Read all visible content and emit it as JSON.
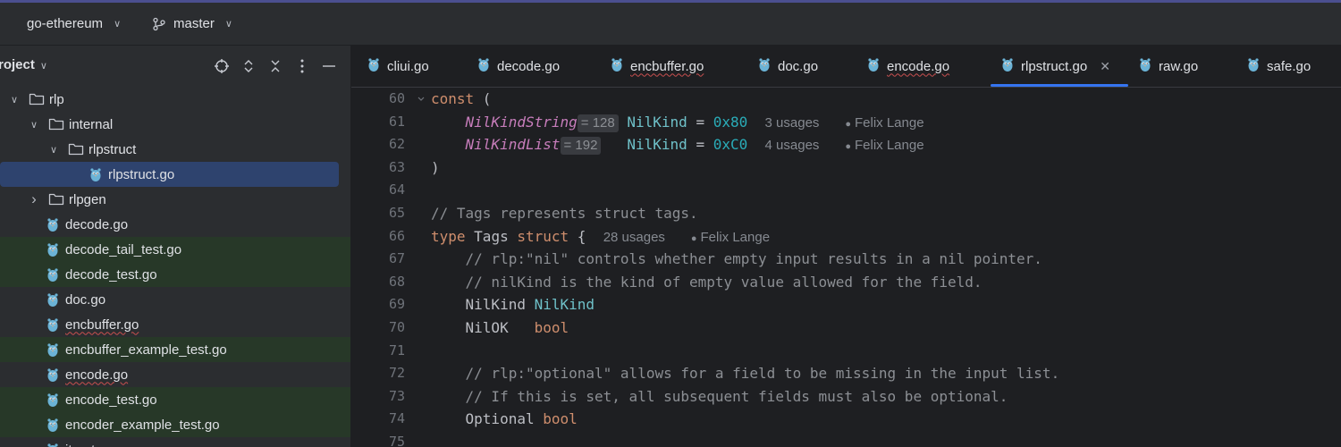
{
  "titlebar": {
    "project_name": "go-ethereum",
    "branch": "master"
  },
  "project_panel": {
    "title": "roject",
    "icons": [
      "locate-icon",
      "expand-collapse-icon",
      "collapse-all-icon",
      "more-icon",
      "minimize-icon"
    ],
    "tree": [
      {
        "label": "rlp",
        "type": "folder",
        "expanded": true,
        "level": 0
      },
      {
        "label": "internal",
        "type": "folder",
        "expanded": true,
        "level": 1
      },
      {
        "label": "rlpstruct",
        "type": "folder",
        "expanded": true,
        "level": 2
      },
      {
        "label": "rlpstruct.go",
        "type": "go-file",
        "selected": true,
        "level": 3
      },
      {
        "label": "rlpgen",
        "type": "folder",
        "expanded": false,
        "level": 1
      },
      {
        "label": "decode.go",
        "type": "go-file",
        "level": 1
      },
      {
        "label": "decode_tail_test.go",
        "type": "go-file",
        "test": true,
        "level": 1
      },
      {
        "label": "decode_test.go",
        "type": "go-file",
        "test": true,
        "level": 1
      },
      {
        "label": "doc.go",
        "type": "go-file",
        "level": 1
      },
      {
        "label": "encbuffer.go",
        "type": "go-file",
        "error": true,
        "level": 1
      },
      {
        "label": "encbuffer_example_test.go",
        "type": "go-file",
        "test": true,
        "level": 1
      },
      {
        "label": "encode.go",
        "type": "go-file",
        "error": true,
        "level": 1
      },
      {
        "label": "encode_test.go",
        "type": "go-file",
        "test": true,
        "level": 1
      },
      {
        "label": "encoder_example_test.go",
        "type": "go-file",
        "test": true,
        "level": 1
      },
      {
        "label": "iterator.go",
        "type": "go-file",
        "level": 1
      }
    ]
  },
  "tabs": [
    {
      "label": "cliui.go",
      "error": false
    },
    {
      "label": "decode.go",
      "error": false
    },
    {
      "label": "encbuffer.go",
      "error": true
    },
    {
      "label": "doc.go",
      "error": false
    },
    {
      "label": "encode.go",
      "error": true
    },
    {
      "label": "rlpstruct.go",
      "error": false,
      "active": true
    },
    {
      "label": "raw.go",
      "error": false
    },
    {
      "label": "safe.go",
      "error": false
    }
  ],
  "editor": {
    "line_numbers": [
      "60",
      "61",
      "62",
      "63",
      "64",
      "65",
      "66",
      "67",
      "68",
      "69",
      "70",
      "71",
      "72",
      "73",
      "74",
      "75"
    ],
    "hints": {
      "nil_kind_string_value": "= 128",
      "nil_kind_list_value": "= 192",
      "usages_3": "3 usages",
      "usages_4": "4 usages",
      "usages_28": "28 usages",
      "author": "Felix Lange"
    },
    "code": {
      "const_kw": "const",
      "open_paren": " (",
      "nil_kind_string": "NilKindString",
      "nil_kind_list": "NilKindList",
      "nil_kind_type": "NilKind",
      "eq": "=",
      "hex_80": "0x80",
      "hex_c0": "0xC0",
      "close_paren": ")",
      "comment_tags": "// Tags represents struct tags.",
      "type_kw": "type",
      "tags_name": "Tags",
      "struct_kw": "struct",
      "open_brace": "{",
      "comment_nil_1": "// rlp:\"nil\" controls whether empty input results in a nil pointer.",
      "comment_nil_2": "// nilKind is the kind of empty value allowed for the field.",
      "field_nilkind": "NilKind",
      "field_nilok": "NilOK",
      "bool_kw": "bool",
      "comment_opt_1": "// rlp:\"optional\" allows for a field to be missing in the input list.",
      "comment_opt_2": "// If this is set, all subsequent fields must also be optional.",
      "field_optional": "Optional"
    }
  },
  "colors": {
    "accent": "#3574f0",
    "keyword": "#cf8e6d",
    "constant": "#c77dbb",
    "number": "#2aacb8",
    "comment": "#8c8f94",
    "test_highlight": "#273828",
    "selection": "#2e436e"
  }
}
